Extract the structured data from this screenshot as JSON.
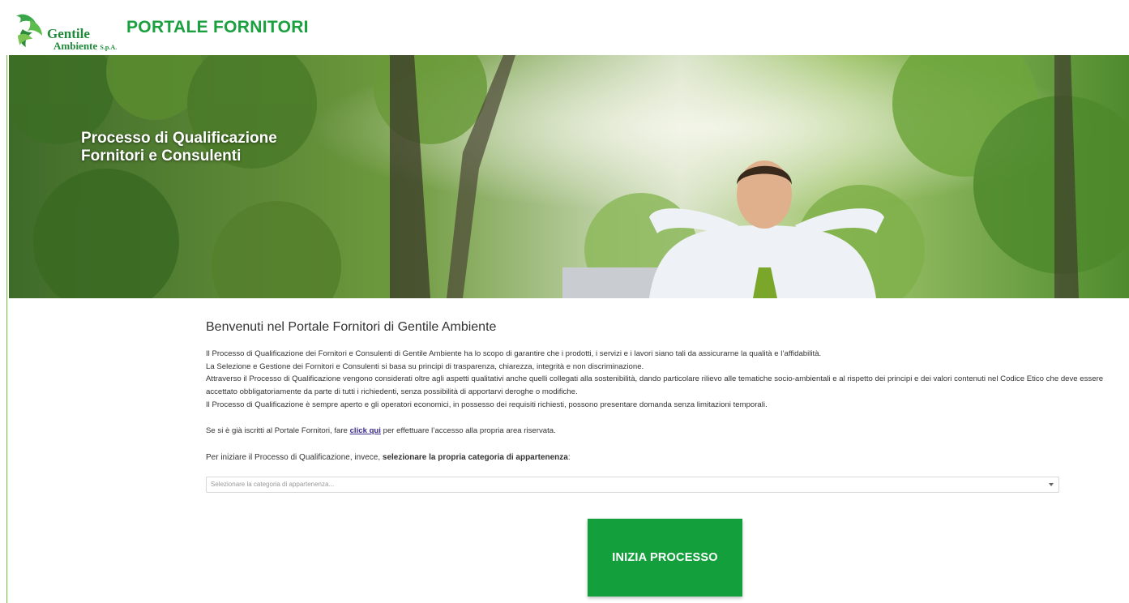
{
  "header": {
    "logo_line1": "Gentile",
    "logo_line2": "Ambiente",
    "logo_suffix": "S.p.A.",
    "portal_title": "PORTALE FORNITORI"
  },
  "hero": {
    "title_line1": "Processo di Qualificazione",
    "title_line2": "Fornitori e Consulenti"
  },
  "content": {
    "welcome": "Benvenuti nel Portale Fornitori di Gentile Ambiente",
    "para1": "Il Processo di Qualificazione dei Fornitori e Consulenti di Gentile Ambiente ha lo scopo di garantire che i prodotti, i servizi e i lavori siano tali da assicurarne la qualità e l’affidabilità.",
    "para2": "La Selezione e Gestione dei Fornitori e Consulenti si basa su principi di trasparenza, chiarezza, integrità e non discriminazione.",
    "para3": "Attraverso il Processo di Qualificazione vengono considerati oltre agli aspetti qualitativi anche quelli collegati alla sostenibilità, dando particolare rilievo alle tematiche socio-ambientali e al rispetto dei principi e dei valori contenuti nel Codice Etico che deve essere accettato obbligatoriamente da parte di tutti i richiedenti, senza possibilità di apportarvi deroghe o modifiche.",
    "para4": "Il Processo di Qualificazione è sempre aperto e gli operatori economici, in possesso dei requisiti richiesti, possono presentare domanda senza limitazioni temporali.",
    "access_prefix": "Se si è già iscritti al Portale Fornitori, fare ",
    "access_link": "click qui",
    "access_suffix": " per effettuare l’accesso alla propria area riservata.",
    "start_prefix": "Per iniziare il Processo di Qualificazione, invece, ",
    "start_bold": "selezionare la propria categoria di appartenenza",
    "start_suffix": ":"
  },
  "category_select": {
    "placeholder": "Selezionare la categoria di appartenenza..."
  },
  "start_button": {
    "label": "INIZIA PROCESSO"
  },
  "colors": {
    "brand_green": "#1aa03e",
    "button_green": "#13a03c",
    "link": "#3a2a8a"
  }
}
